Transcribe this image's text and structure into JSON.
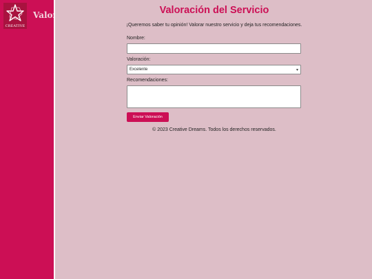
{
  "sidebar": {
    "logo_text": "CREATIVE",
    "title": "Valora"
  },
  "main": {
    "title": "Valoración del Servicio",
    "intro": "¡Queremos saber tu opinión! Valorar nuestro servicio y deja tus recomendaciones.",
    "form": {
      "name_label": "Nombre:",
      "name_value": "",
      "rating_label": "Valoración:",
      "rating_value": "Excelente",
      "recommendations_label": "Recomendaciones:",
      "recommendations_value": "",
      "submit_label": "Enviar Valoración"
    },
    "footer": "© 2023 Creative Dreams. Todos los derechos reservados."
  },
  "colors": {
    "brand": "#cc0f55",
    "background": "#ddbec7",
    "logo_bg": "#a9123f"
  },
  "icons": {
    "logo": "star-logo-icon",
    "select": "chevron-down-icon"
  }
}
